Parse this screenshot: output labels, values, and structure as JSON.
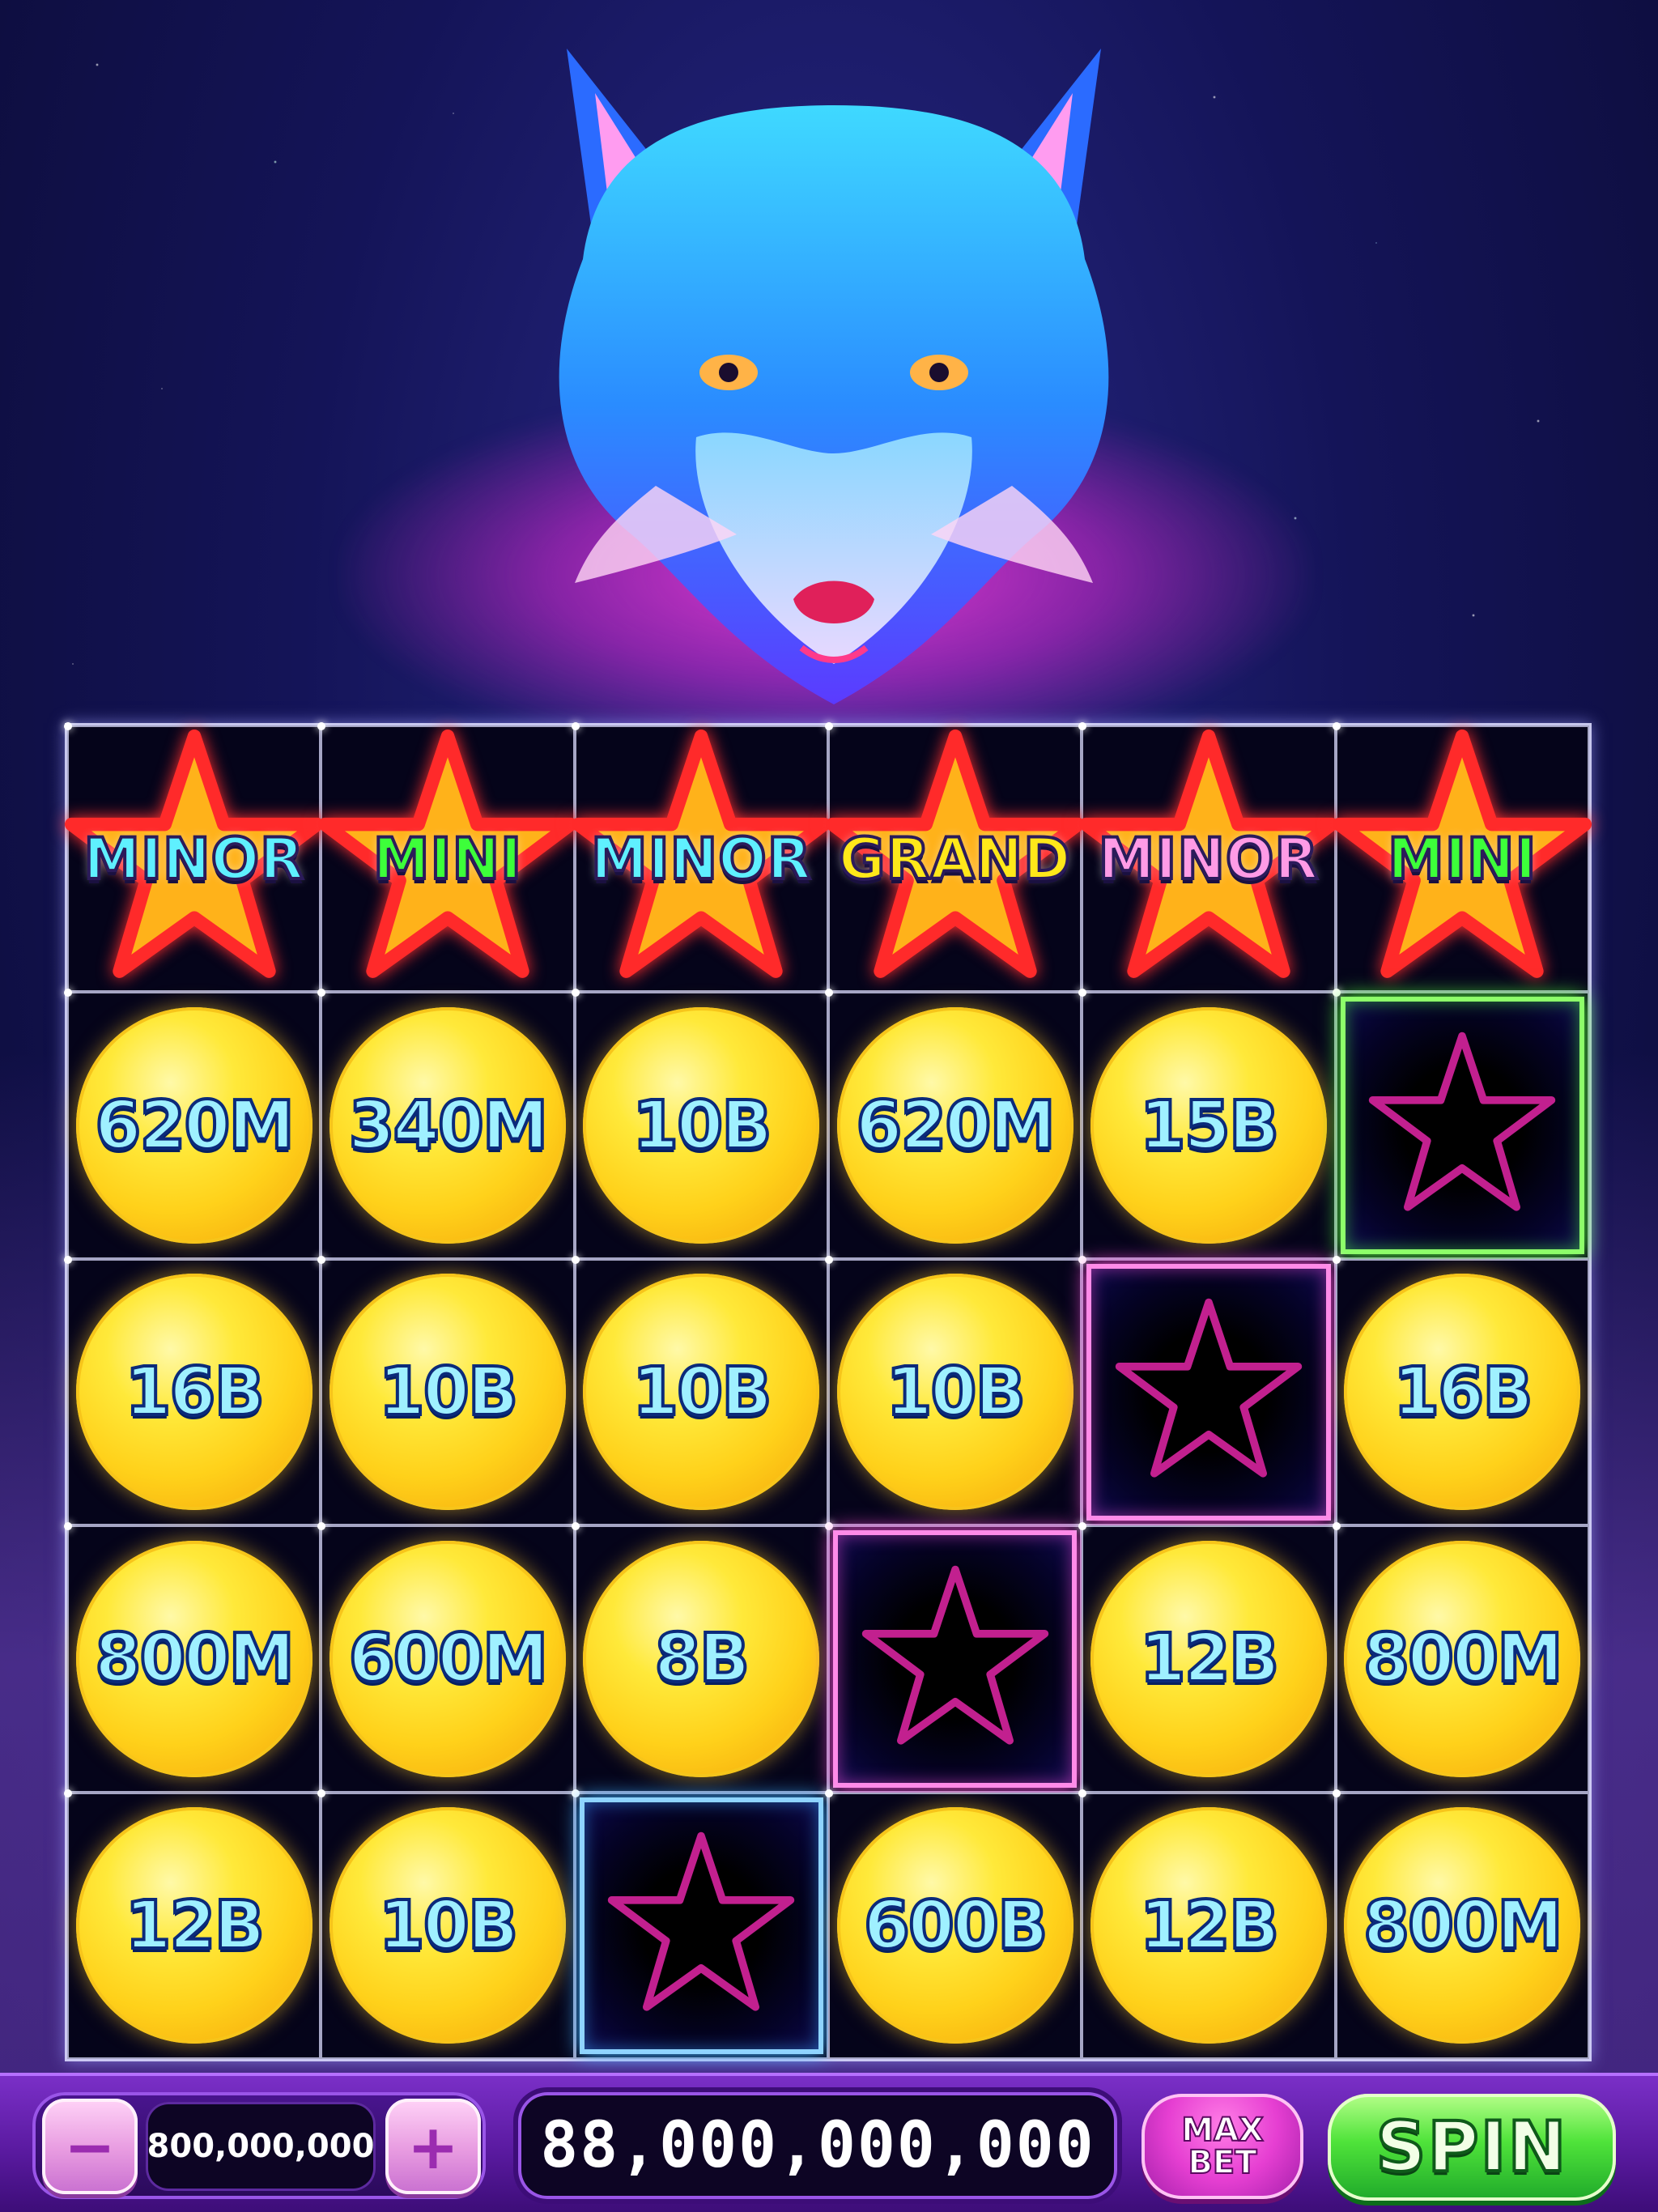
{
  "jackpots": [
    {
      "label": "MINOR",
      "color": "#5ff0ff"
    },
    {
      "label": "MINI",
      "color": "#3dff3a"
    },
    {
      "label": "MINOR",
      "color": "#5ff0ff"
    },
    {
      "label": "GRAND",
      "color": "#ffe81a"
    },
    {
      "label": "MINOR",
      "color": "#ff9be6"
    },
    {
      "label": "MINI",
      "color": "#3dff3a"
    }
  ],
  "reels": [
    [
      {
        "type": "coin",
        "value": "620M"
      },
      {
        "type": "coin",
        "value": "340M"
      },
      {
        "type": "coin",
        "value": "10B"
      },
      {
        "type": "coin",
        "value": "620M"
      },
      {
        "type": "coin",
        "value": "15B"
      },
      {
        "type": "empty",
        "glow": "green"
      }
    ],
    [
      {
        "type": "coin",
        "value": "16B"
      },
      {
        "type": "coin",
        "value": "10B"
      },
      {
        "type": "coin",
        "value": "10B"
      },
      {
        "type": "coin",
        "value": "10B"
      },
      {
        "type": "empty",
        "glow": "pink"
      },
      {
        "type": "coin",
        "value": "16B"
      }
    ],
    [
      {
        "type": "coin",
        "value": "800M"
      },
      {
        "type": "coin",
        "value": "600M"
      },
      {
        "type": "coin",
        "value": "8B"
      },
      {
        "type": "empty",
        "glow": "pink"
      },
      {
        "type": "coin",
        "value": "12B"
      },
      {
        "type": "coin",
        "value": "800M"
      }
    ],
    [
      {
        "type": "coin",
        "value": "12B"
      },
      {
        "type": "coin",
        "value": "10B"
      },
      {
        "type": "empty",
        "glow": "blue"
      },
      {
        "type": "coin",
        "value": "600B"
      },
      {
        "type": "coin",
        "value": "12B"
      },
      {
        "type": "coin",
        "value": "800M"
      }
    ]
  ],
  "controls": {
    "minus_label": "−",
    "plus_label": "+",
    "bet_amount": "800,000,000",
    "win_amount": "88,000,000,000",
    "max_bet_line1": "MAX",
    "max_bet_line2": "BET",
    "spin_label": "SPIN"
  },
  "icons": {
    "minus": "minus-icon",
    "plus": "plus-icon",
    "star": "star-icon"
  }
}
